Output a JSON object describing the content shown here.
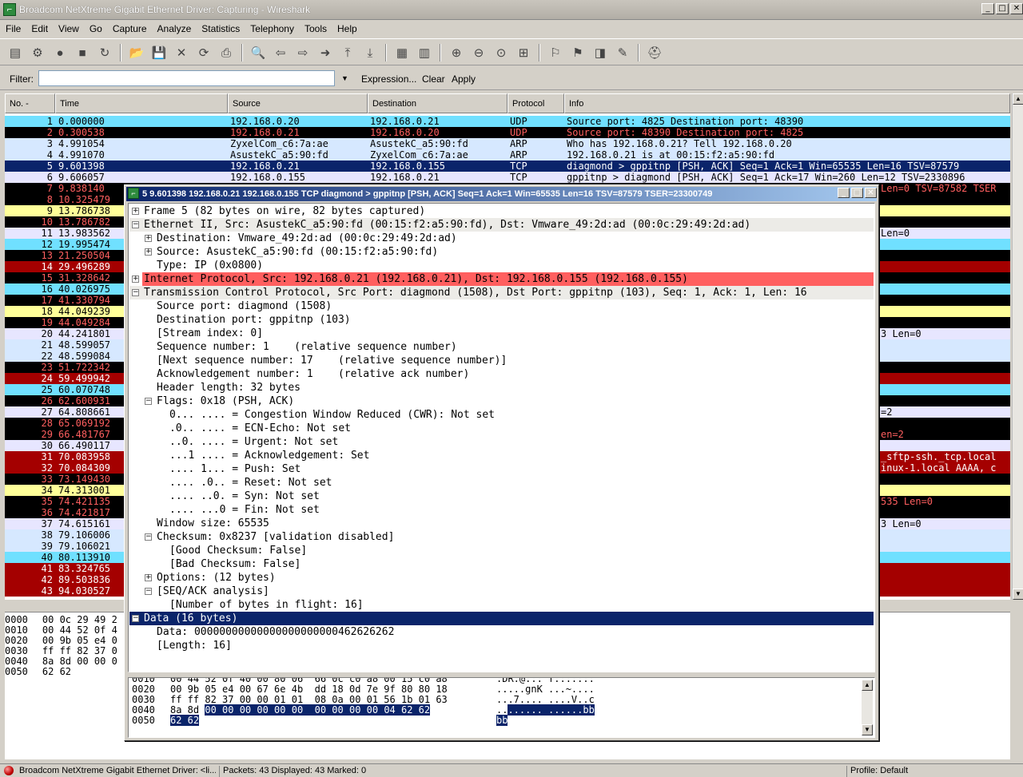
{
  "window": {
    "title": "Broadcom NetXtreme Gigabit Ethernet Driver: Capturing - Wireshark"
  },
  "menu": [
    "File",
    "Edit",
    "View",
    "Go",
    "Capture",
    "Analyze",
    "Statistics",
    "Telephony",
    "Tools",
    "Help"
  ],
  "toolbar_icons": [
    "interface-list-icon",
    "capture-options-icon",
    "start-capture-icon",
    "stop-capture-icon",
    "restart-capture-icon",
    "open-file-icon",
    "save-file-icon",
    "close-file-icon",
    "reload-icon",
    "print-icon",
    "find-packet-icon",
    "go-back-icon",
    "go-forward-icon",
    "go-to-packet-icon",
    "go-first-icon",
    "go-last-icon",
    "colorize-icon",
    "auto-scroll-icon",
    "zoom-in-icon",
    "zoom-out-icon",
    "normal-size-icon",
    "resize-columns-icon",
    "capture-filters-icon",
    "display-filters-icon",
    "coloring-rules-icon",
    "preferences-icon",
    "help-icon"
  ],
  "filter": {
    "label": "Filter:",
    "value": "",
    "expression": "Expression...",
    "clear": "Clear",
    "apply": "Apply"
  },
  "columns": [
    "No. -",
    "Time",
    "Source",
    "Destination",
    "Protocol",
    "Info"
  ],
  "colors": {
    "udp": "#70e0ff",
    "arp": "#d6e8ff",
    "tcp": "#e7e6ff",
    "selected": "#0a246a",
    "black": "#000000",
    "darkred": "#a40000",
    "yellow": "#ffff99",
    "red_hl": "#ff5f5f"
  },
  "packets": [
    {
      "no": "1",
      "time": "0.000000",
      "src": "192.168.0.20",
      "dst": "192.168.0.21",
      "proto": "UDP",
      "info": "Source port: 4825  Destination port: 48390",
      "style": "udp"
    },
    {
      "no": "2",
      "time": "0.300538",
      "src": "192.168.0.21",
      "dst": "192.168.0.20",
      "proto": "UDP",
      "info": "Source port: 48390  Destination port: 4825",
      "style": "black"
    },
    {
      "no": "3",
      "time": "4.991054",
      "src": "ZyxelCom_c6:7a:ae",
      "dst": "AsustekC_a5:90:fd",
      "proto": "ARP",
      "info": "Who has 192.168.0.21?  Tell 192.168.0.20",
      "style": "arp"
    },
    {
      "no": "4",
      "time": "4.991070",
      "src": "AsustekC_a5:90:fd",
      "dst": "ZyxelCom_c6:7a:ae",
      "proto": "ARP",
      "info": "192.168.0.21 is at 00:15:f2:a5:90:fd",
      "style": "arp"
    },
    {
      "no": "5",
      "time": "9.601398",
      "src": "192.168.0.21",
      "dst": "192.168.0.155",
      "proto": "TCP",
      "info": "diagmond > gppitnp [PSH, ACK] Seq=1 Ack=1 Win=65535 Len=16 TSV=87579",
      "style": "selected"
    },
    {
      "no": "6",
      "time": "9.606057",
      "src": "192.168.0.155",
      "dst": "192.168.0.21",
      "proto": "TCP",
      "info": "gppitnp > diagmond [PSH, ACK] Seq=1 Ack=17 Win=260 Len=12 TSV=2330896",
      "style": "tcp"
    },
    {
      "no": "7",
      "time": "9.838140",
      "src": "",
      "dst": "",
      "proto": "",
      "info": "Len=0 TSV=87582 TSER",
      "style": "black"
    },
    {
      "no": "8",
      "time": "10.325479",
      "src": "",
      "dst": "",
      "proto": "",
      "info": "",
      "style": "black"
    },
    {
      "no": "9",
      "time": "13.786738",
      "src": "",
      "dst": "",
      "proto": "",
      "info": "",
      "style": "yellow"
    },
    {
      "no": "10",
      "time": "13.786782",
      "src": "",
      "dst": "",
      "proto": "",
      "info": "",
      "style": "black"
    },
    {
      "no": "11",
      "time": "13.983562",
      "src": "",
      "dst": "",
      "proto": "",
      "info": "Len=0",
      "style": "tcp"
    },
    {
      "no": "12",
      "time": "19.995474",
      "src": "",
      "dst": "",
      "proto": "",
      "info": "",
      "style": "udp"
    },
    {
      "no": "13",
      "time": "21.250504",
      "src": "",
      "dst": "",
      "proto": "",
      "info": "",
      "style": "black"
    },
    {
      "no": "14",
      "time": "29.496289",
      "src": "",
      "dst": "",
      "proto": "",
      "info": "",
      "style": "darkred"
    },
    {
      "no": "15",
      "time": "31.328642",
      "src": "",
      "dst": "",
      "proto": "",
      "info": "",
      "style": "black"
    },
    {
      "no": "16",
      "time": "40.026975",
      "src": "",
      "dst": "",
      "proto": "",
      "info": "",
      "style": "udp"
    },
    {
      "no": "17",
      "time": "41.330794",
      "src": "",
      "dst": "",
      "proto": "",
      "info": "",
      "style": "black"
    },
    {
      "no": "18",
      "time": "44.049239",
      "src": "",
      "dst": "",
      "proto": "",
      "info": "",
      "style": "yellow"
    },
    {
      "no": "19",
      "time": "44.049284",
      "src": "",
      "dst": "",
      "proto": "",
      "info": "",
      "style": "black"
    },
    {
      "no": "20",
      "time": "44.241801",
      "src": "",
      "dst": "",
      "proto": "",
      "info": "3 Len=0",
      "style": "tcp"
    },
    {
      "no": "21",
      "time": "48.599057",
      "src": "",
      "dst": "",
      "proto": "",
      "info": "",
      "style": "arp"
    },
    {
      "no": "22",
      "time": "48.599084",
      "src": "",
      "dst": "",
      "proto": "",
      "info": "",
      "style": "arp"
    },
    {
      "no": "23",
      "time": "51.722342",
      "src": "",
      "dst": "",
      "proto": "",
      "info": "",
      "style": "black"
    },
    {
      "no": "24",
      "time": "59.499942",
      "src": "",
      "dst": "",
      "proto": "",
      "info": "",
      "style": "darkred"
    },
    {
      "no": "25",
      "time": "60.070748",
      "src": "",
      "dst": "",
      "proto": "",
      "info": "",
      "style": "udp"
    },
    {
      "no": "26",
      "time": "62.600931",
      "src": "",
      "dst": "",
      "proto": "",
      "info": "",
      "style": "black"
    },
    {
      "no": "27",
      "time": "64.808661",
      "src": "",
      "dst": "",
      "proto": "",
      "info": "=2",
      "style": "tcp"
    },
    {
      "no": "28",
      "time": "65.069192",
      "src": "",
      "dst": "",
      "proto": "",
      "info": "",
      "style": "black"
    },
    {
      "no": "29",
      "time": "66.481767",
      "src": "",
      "dst": "",
      "proto": "",
      "info": "en=2",
      "style": "black"
    },
    {
      "no": "30",
      "time": "66.490117",
      "src": "",
      "dst": "",
      "proto": "",
      "info": "",
      "style": "tcp"
    },
    {
      "no": "31",
      "time": "70.083958",
      "src": "",
      "dst": "",
      "proto": "",
      "info": "_sftp-ssh._tcp.local",
      "style": "darkred"
    },
    {
      "no": "32",
      "time": "70.084309",
      "src": "",
      "dst": "",
      "proto": "",
      "info": "inux-1.local AAAA, c",
      "style": "darkred"
    },
    {
      "no": "33",
      "time": "73.149430",
      "src": "",
      "dst": "",
      "proto": "",
      "info": "",
      "style": "black"
    },
    {
      "no": "34",
      "time": "74.313001",
      "src": "",
      "dst": "",
      "proto": "",
      "info": "",
      "style": "yellow"
    },
    {
      "no": "35",
      "time": "74.421135",
      "src": "",
      "dst": "",
      "proto": "",
      "info": "535 Len=0",
      "style": "black"
    },
    {
      "no": "36",
      "time": "74.421817",
      "src": "",
      "dst": "",
      "proto": "",
      "info": "",
      "style": "black"
    },
    {
      "no": "37",
      "time": "74.615161",
      "src": "",
      "dst": "",
      "proto": "",
      "info": "3 Len=0",
      "style": "tcp"
    },
    {
      "no": "38",
      "time": "79.106006",
      "src": "",
      "dst": "",
      "proto": "",
      "info": "",
      "style": "arp"
    },
    {
      "no": "39",
      "time": "79.106021",
      "src": "",
      "dst": "",
      "proto": "",
      "info": "",
      "style": "arp"
    },
    {
      "no": "40",
      "time": "80.113910",
      "src": "",
      "dst": "",
      "proto": "",
      "info": "",
      "style": "udp"
    },
    {
      "no": "41",
      "time": "83.324765",
      "src": "",
      "dst": "",
      "proto": "",
      "info": "",
      "style": "darkred"
    },
    {
      "no": "42",
      "time": "89.503836",
      "src": "",
      "dst": "",
      "proto": "",
      "info": "",
      "style": "darkred"
    },
    {
      "no": "43",
      "time": "94.030527",
      "src": "",
      "dst": "",
      "proto": "",
      "info": "",
      "style": "darkred"
    }
  ],
  "lower_hex": [
    {
      "off": "0000",
      "bytes": "00 0c 29 49 2"
    },
    {
      "off": "0010",
      "bytes": "00 44 52 0f 4"
    },
    {
      "off": "0020",
      "bytes": "00 9b 05 e4 0"
    },
    {
      "off": "0030",
      "bytes": "ff ff 82 37 0"
    },
    {
      "off": "0040",
      "bytes": "8a 8d 00 00 0"
    },
    {
      "off": "0050",
      "bytes": "62 62"
    }
  ],
  "popup": {
    "title": "5 9.601398 192.168.0.21 192.168.0.155 TCP diagmond > gppitnp [PSH, ACK] Seq=1 Ack=1 Win=65535 Len=16 TSV=87579 TSER=23300749",
    "tree": [
      {
        "indent": 0,
        "exp": "+",
        "text": "Frame 5 (82 bytes on wire, 82 bytes captured)",
        "style": "normal"
      },
      {
        "indent": 0,
        "exp": "-",
        "text": "Ethernet II, Src: AsustekC_a5:90:fd (00:15:f2:a5:90:fd), Dst: Vmware_49:2d:ad (00:0c:29:49:2d:ad)",
        "style": "band"
      },
      {
        "indent": 1,
        "exp": "+",
        "text": "Destination: Vmware_49:2d:ad (00:0c:29:49:2d:ad)",
        "style": "normal"
      },
      {
        "indent": 1,
        "exp": "+",
        "text": "Source: AsustekC_a5:90:fd (00:15:f2:a5:90:fd)",
        "style": "normal"
      },
      {
        "indent": 1,
        "exp": "",
        "text": "Type: IP (0x0800)",
        "style": "normal"
      },
      {
        "indent": 0,
        "exp": "+",
        "text": "Internet Protocol, Src: 192.168.0.21 (192.168.0.21), Dst: 192.168.0.155 (192.168.0.155)",
        "style": "red"
      },
      {
        "indent": 0,
        "exp": "-",
        "text": "Transmission Control Protocol, Src Port: diagmond (1508), Dst Port: gppitnp (103), Seq: 1, Ack: 1, Len: 16",
        "style": "band"
      },
      {
        "indent": 1,
        "exp": "",
        "text": "Source port: diagmond (1508)",
        "style": "normal"
      },
      {
        "indent": 1,
        "exp": "",
        "text": "Destination port: gppitnp (103)",
        "style": "normal"
      },
      {
        "indent": 1,
        "exp": "",
        "text": "[Stream index: 0]",
        "style": "normal"
      },
      {
        "indent": 1,
        "exp": "",
        "text": "Sequence number: 1    (relative sequence number)",
        "style": "normal"
      },
      {
        "indent": 1,
        "exp": "",
        "text": "[Next sequence number: 17    (relative sequence number)]",
        "style": "normal"
      },
      {
        "indent": 1,
        "exp": "",
        "text": "Acknowledgement number: 1    (relative ack number)",
        "style": "normal"
      },
      {
        "indent": 1,
        "exp": "",
        "text": "Header length: 32 bytes",
        "style": "normal"
      },
      {
        "indent": 1,
        "exp": "-",
        "text": "Flags: 0x18 (PSH, ACK)",
        "style": "normal"
      },
      {
        "indent": 2,
        "exp": "",
        "text": "0... .... = Congestion Window Reduced (CWR): Not set",
        "style": "normal"
      },
      {
        "indent": 2,
        "exp": "",
        "text": ".0.. .... = ECN-Echo: Not set",
        "style": "normal"
      },
      {
        "indent": 2,
        "exp": "",
        "text": "..0. .... = Urgent: Not set",
        "style": "normal"
      },
      {
        "indent": 2,
        "exp": "",
        "text": "...1 .... = Acknowledgement: Set",
        "style": "normal"
      },
      {
        "indent": 2,
        "exp": "",
        "text": ".... 1... = Push: Set",
        "style": "normal"
      },
      {
        "indent": 2,
        "exp": "",
        "text": ".... .0.. = Reset: Not set",
        "style": "normal"
      },
      {
        "indent": 2,
        "exp": "",
        "text": ".... ..0. = Syn: Not set",
        "style": "normal"
      },
      {
        "indent": 2,
        "exp": "",
        "text": ".... ...0 = Fin: Not set",
        "style": "normal"
      },
      {
        "indent": 1,
        "exp": "",
        "text": "Window size: 65535",
        "style": "normal"
      },
      {
        "indent": 1,
        "exp": "-",
        "text": "Checksum: 0x8237 [validation disabled]",
        "style": "normal"
      },
      {
        "indent": 2,
        "exp": "",
        "text": "[Good Checksum: False]",
        "style": "normal"
      },
      {
        "indent": 2,
        "exp": "",
        "text": "[Bad Checksum: False]",
        "style": "normal"
      },
      {
        "indent": 1,
        "exp": "+",
        "text": "Options: (12 bytes)",
        "style": "normal"
      },
      {
        "indent": 1,
        "exp": "-",
        "text": "[SEQ/ACK analysis]",
        "style": "normal"
      },
      {
        "indent": 2,
        "exp": "",
        "text": "[Number of bytes in flight: 16]",
        "style": "normal"
      },
      {
        "indent": 0,
        "exp": "-",
        "text": "Data (16 bytes)",
        "style": "selected"
      },
      {
        "indent": 1,
        "exp": "",
        "text": "Data: 00000000000000000000000462626262",
        "style": "normal"
      },
      {
        "indent": 1,
        "exp": "",
        "text": "[Length: 16]",
        "style": "normal"
      }
    ],
    "hex": [
      {
        "off": "0010",
        "plain": "00 44 52 0f 40 00 80 06  66 0c c0 a8 00 15 c0 a8",
        "hl": "",
        "ascii": ".DR.@... f.......",
        "ascii_hl": ""
      },
      {
        "off": "0020",
        "plain": "00 9b 05 e4 00 67 6e 4b  dd 18 0d 7e 9f 80 80 18",
        "hl": "",
        "ascii": ".....gnK ...~....",
        "ascii_hl": ""
      },
      {
        "off": "0030",
        "plain": "ff ff 82 37 00 00 01 01  08 0a 00 01 56 1b 01 63",
        "hl": "",
        "ascii": "...7.... ....V..c",
        "ascii_hl": ""
      },
      {
        "off": "0040",
        "plain": "8a 8d ",
        "hl": "00 00 00 00 00 00  00 00 00 00 04 62 62",
        "ascii": "..",
        "ascii_hl": "...... ......bb"
      },
      {
        "off": "0050",
        "plain": "",
        "hl": "62 62",
        "ascii": "",
        "ascii_hl": "bb"
      }
    ]
  },
  "status": {
    "interface": "Broadcom NetXtreme Gigabit Ethernet Driver: <li...",
    "packets": "Packets: 43 Displayed: 43 Marked: 0",
    "profile": "Profile: Default"
  }
}
